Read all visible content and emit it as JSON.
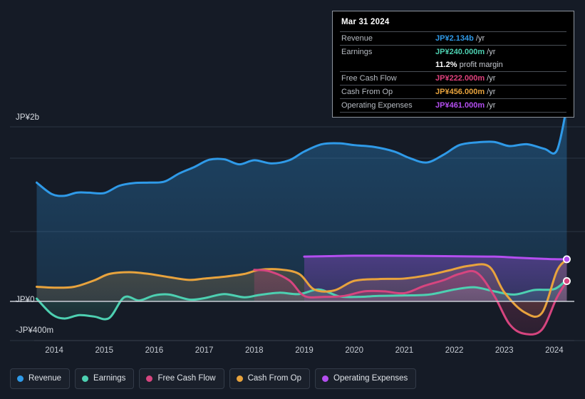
{
  "background_color": "#151b26",
  "tooltip": {
    "date": "Mar 31 2024",
    "rows": [
      {
        "key": "Revenue",
        "value": "JP¥2.134b",
        "unit": "/yr",
        "color": "#2f9ae8"
      },
      {
        "key": "Earnings",
        "value": "JP¥240.000m",
        "unit": "/yr",
        "color": "#4dd0b1"
      },
      {
        "key": "",
        "value": "11.2%",
        "unit": "profit margin",
        "color": "#ffffff"
      },
      {
        "key": "Free Cash Flow",
        "value": "JP¥222.000m",
        "unit": "/yr",
        "color": "#e0417d"
      },
      {
        "key": "Cash From Op",
        "value": "JP¥456.000m",
        "unit": "/yr",
        "color": "#e8a33d"
      },
      {
        "key": "Operating Expenses",
        "value": "JP¥461.000m",
        "unit": "/yr",
        "color": "#b44ef0"
      }
    ]
  },
  "legend": {
    "items": [
      {
        "label": "Revenue",
        "color": "#2f9ae8"
      },
      {
        "label": "Earnings",
        "color": "#4dd0b1"
      },
      {
        "label": "Free Cash Flow",
        "color": "#d6457f"
      },
      {
        "label": "Cash From Op",
        "color": "#e8a33d"
      },
      {
        "label": "Operating Expenses",
        "color": "#b44ef0"
      }
    ]
  },
  "chart_data": {
    "type": "area",
    "title": "",
    "xlabel": "",
    "ylabel": "",
    "currency": "JP¥",
    "grid": true,
    "legend_position": "bottom",
    "y_ticks": [
      {
        "label": "JP¥2b",
        "value": 2000
      },
      {
        "label": "JP¥0",
        "value": 0
      },
      {
        "label": "-JP¥400m",
        "value": -400
      }
    ],
    "ylim": [
      -400,
      2000
    ],
    "x_ticks": [
      "2014",
      "2015",
      "2016",
      "2017",
      "2018",
      "2019",
      "2020",
      "2021",
      "2022",
      "2023",
      "2024"
    ],
    "xlim": [
      "2013.6",
      "2024.4"
    ],
    "series": [
      {
        "name": "Revenue",
        "color": "#2f9ae8",
        "fill": "rgba(47,154,232,0.22)",
        "x": [
          2013.65,
          2013.95,
          2014.2,
          2014.45,
          2014.7,
          2015.0,
          2015.3,
          2015.6,
          2015.9,
          2016.2,
          2016.5,
          2016.8,
          2017.1,
          2017.4,
          2017.7,
          2018.0,
          2018.35,
          2018.7,
          2019.0,
          2019.35,
          2019.7,
          2020.0,
          2020.4,
          2020.8,
          2021.1,
          2021.45,
          2021.8,
          2022.1,
          2022.45,
          2022.8,
          2023.1,
          2023.45,
          2023.8,
          2024.05,
          2024.25
        ],
        "values": [
          1300,
          1175,
          1155,
          1190,
          1190,
          1185,
          1265,
          1295,
          1300,
          1310,
          1400,
          1470,
          1550,
          1555,
          1500,
          1545,
          1510,
          1545,
          1640,
          1720,
          1730,
          1710,
          1690,
          1640,
          1570,
          1520,
          1610,
          1710,
          1740,
          1745,
          1700,
          1720,
          1670,
          1650,
          2134
        ]
      },
      {
        "name": "Earnings",
        "color": "#4dd0b1",
        "fill": "rgba(77,208,177,0.18)",
        "x": [
          2013.65,
          2013.95,
          2014.2,
          2014.5,
          2014.8,
          2015.1,
          2015.4,
          2015.7,
          2016.0,
          2016.3,
          2016.7,
          2017.0,
          2017.4,
          2017.8,
          2018.1,
          2018.5,
          2018.9,
          2019.3,
          2019.7,
          2020.1,
          2020.5,
          2021.0,
          2021.5,
          2022.0,
          2022.4,
          2022.8,
          2023.2,
          2023.6,
          2024.0,
          2024.25
        ],
        "values": [
          30,
          -130,
          -175,
          -140,
          -155,
          -170,
          45,
          10,
          65,
          75,
          20,
          35,
          80,
          45,
          70,
          95,
          80,
          130,
          55,
          50,
          60,
          65,
          75,
          130,
          155,
          110,
          75,
          125,
          135,
          240
        ]
      },
      {
        "name": "Free Cash Flow",
        "color": "#d6457f",
        "fill": "rgba(214,69,127,0.18)",
        "x": [
          2018.0,
          2018.3,
          2018.7,
          2019.0,
          2019.4,
          2019.8,
          2020.2,
          2020.6,
          2021.0,
          2021.4,
          2021.8,
          2022.1,
          2022.45,
          2022.8,
          2023.1,
          2023.4,
          2023.75,
          2024.05,
          2024.25
        ],
        "values": [
          345,
          330,
          230,
          60,
          50,
          60,
          110,
          110,
          90,
          170,
          235,
          300,
          315,
          60,
          -230,
          -330,
          -290,
          40,
          222
        ]
      },
      {
        "name": "Cash From Op",
        "color": "#e8a33d",
        "fill": "rgba(232,163,61,0.17)",
        "x": [
          2013.65,
          2014.0,
          2014.4,
          2014.8,
          2015.1,
          2015.5,
          2015.9,
          2016.3,
          2016.7,
          2017.0,
          2017.4,
          2017.8,
          2018.1,
          2018.5,
          2018.9,
          2019.2,
          2019.6,
          2020.0,
          2020.5,
          2021.0,
          2021.5,
          2021.9,
          2022.3,
          2022.7,
          2023.0,
          2023.4,
          2023.75,
          2024.05,
          2024.25
        ],
        "values": [
          160,
          150,
          160,
          230,
          300,
          320,
          300,
          265,
          235,
          250,
          270,
          300,
          345,
          350,
          300,
          130,
          120,
          225,
          245,
          250,
          290,
          340,
          390,
          380,
          100,
          -110,
          -120,
          330,
          456
        ]
      },
      {
        "name": "Operating Expenses",
        "color": "#b44ef0",
        "fill": "rgba(180,78,240,0.22)",
        "x": [
          2019.0,
          2019.5,
          2020.0,
          2020.6,
          2021.2,
          2021.8,
          2022.3,
          2022.8,
          2023.2,
          2023.6,
          2024.0,
          2024.25
        ],
        "values": [
          490,
          495,
          500,
          500,
          498,
          495,
          492,
          490,
          480,
          470,
          462,
          461
        ]
      }
    ],
    "end_markers": [
      {
        "series": "Revenue",
        "color": "#2f9ae8"
      },
      {
        "series": "Operating Expenses",
        "color": "#b44ef0"
      },
      {
        "series": "Free Cash Flow",
        "color": "#d6457f"
      }
    ]
  }
}
